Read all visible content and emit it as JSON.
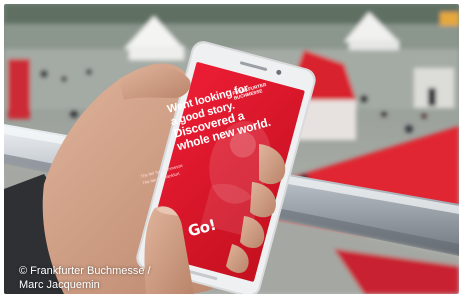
{
  "photo": {
    "description_icon": "phone-in-hand-photo",
    "colors": {
      "red": "#e4192c",
      "sky": "#c9ccc8",
      "rail": "#c7ccd2"
    }
  },
  "phone": {
    "brand_line1": "Frankfurter",
    "brand_line2": "Buchmesse",
    "headline": [
      "Went looking for",
      "a good story.",
      "Discovered a",
      "whole new world."
    ],
    "small_lines": [
      "The fair for Buchmesse",
      "The fair for Frankfurt"
    ],
    "logo": "Go!"
  },
  "credit": {
    "line1": "© Frankfurter Buchmesse /",
    "line2": "Marc Jacquemin"
  }
}
